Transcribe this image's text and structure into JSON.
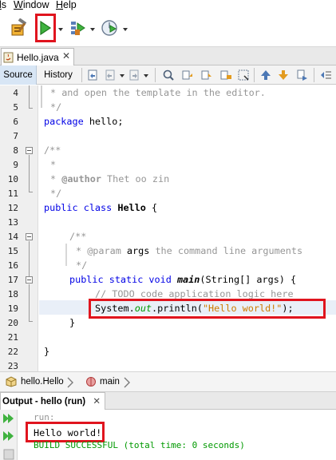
{
  "menu": {
    "items": [
      {
        "label": "ls",
        "accel": "l",
        "rest": "s"
      },
      {
        "label": "Window",
        "accel": "W",
        "rest": "indow"
      },
      {
        "label": "Help",
        "accel": "H",
        "rest": "elp"
      }
    ]
  },
  "toolbar": {
    "icons": [
      "build-project-icon",
      "run-project-icon",
      "debug-project-icon",
      "profile-project-icon"
    ]
  },
  "editor_tab": {
    "filename": "Hello.java",
    "close": "✕"
  },
  "editor_toolbar": {
    "source_label": "Source",
    "history_label": "History"
  },
  "code": {
    "line_numbers": [
      "4",
      "5",
      "6",
      "7",
      "8",
      "9",
      "10",
      "11",
      "12",
      "13",
      "14",
      "15",
      "16",
      "17",
      "18",
      "19",
      "20",
      "21",
      "22",
      "23"
    ],
    "lines": {
      "l4": "* and open the template in the editor.",
      "l5": "*/",
      "l6_kw": "package",
      "l6_rest": " hello;",
      "l8": "/**",
      "l9": "*",
      "l10_pre": "* ",
      "l10_tag": "@author",
      "l10_rest": " Thet oo zin",
      "l11": "*/",
      "l12_kw": "public class",
      "l12_name": " Hello",
      "l12_rest": " {",
      "l14": "/**",
      "l15_pre": "* @param ",
      "l15_arg": "args",
      "l15_rest": " the command line arguments",
      "l16": "*/",
      "l17_kw": "public static void",
      "l17_name": " main",
      "l17_rest": "(String[] args) {",
      "l18": "// TODO code application logic here",
      "l19_a": "System.",
      "l19_fld": "out",
      "l19_b": ".println(",
      "l19_str": "\"Hello world!\"",
      "l19_c": ");",
      "l20": "}",
      "l22": "}"
    }
  },
  "breadcrumb": {
    "class_label": "hello.Hello",
    "method_label": "main"
  },
  "output": {
    "tab_label": "Output - hello (run)",
    "close": "✕",
    "lines": [
      "run:",
      "Hello world!",
      "BUILD SUCCESSFUL (total time: 0 seconds)"
    ]
  },
  "colors": {
    "highlight": "#e0141e",
    "keyword": "#0000e6",
    "comment": "#969696",
    "string": "#ce7b00",
    "success": "#009900"
  }
}
